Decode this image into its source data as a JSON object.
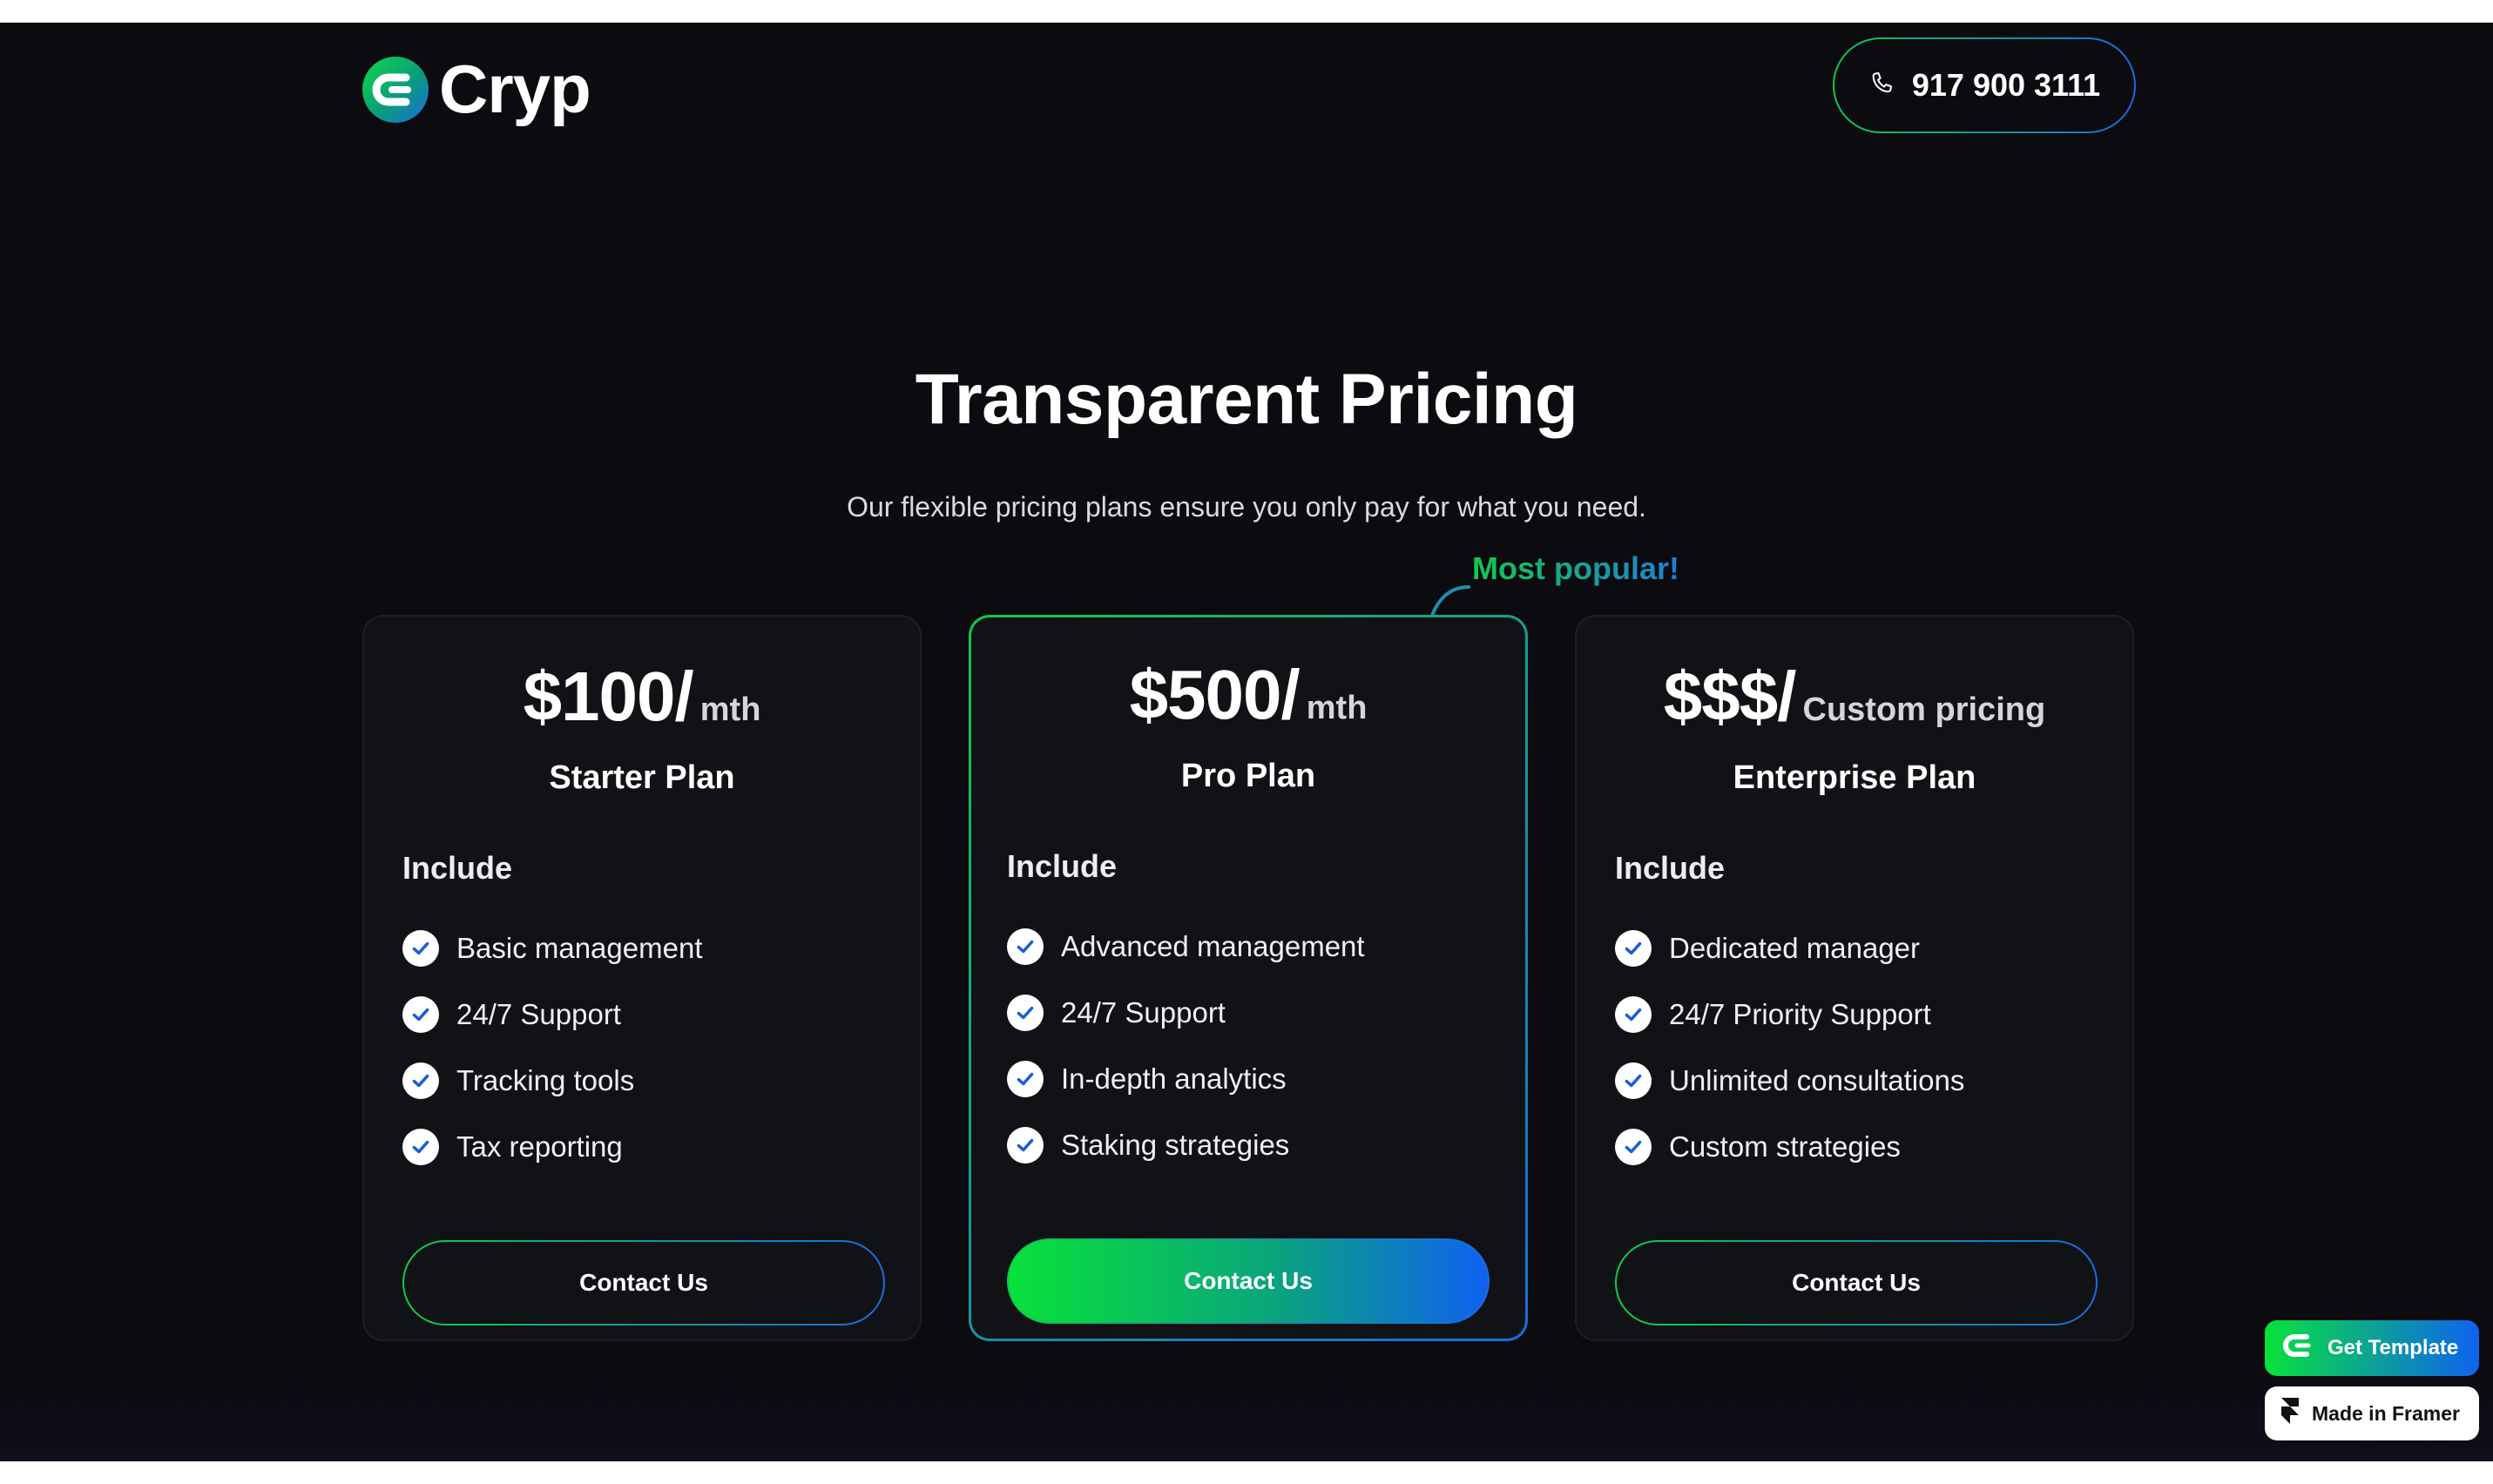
{
  "header": {
    "brand": "Cryp",
    "phone": "917 900 3111"
  },
  "hero": {
    "title": "Transparent Pricing",
    "subtitle": "Our flexible pricing plans ensure you only pay for what you need.",
    "popular_label": "Most popular!"
  },
  "plans": [
    {
      "price": "$100/",
      "period": "mth",
      "name": "Starter Plan",
      "include_label": "Include",
      "features": [
        "Basic management",
        "24/7 Support",
        "Tracking tools",
        "Tax reporting"
      ],
      "cta": "Contact Us"
    },
    {
      "price": "$500/",
      "period": "mth",
      "name": "Pro Plan",
      "include_label": "Include",
      "features": [
        "Advanced management",
        "24/7 Support",
        "In-depth analytics",
        "Staking strategies"
      ],
      "cta": "Contact Us"
    },
    {
      "price": "$$$/",
      "period": "Custom pricing",
      "name": "Enterprise Plan",
      "include_label": "Include",
      "features": [
        "Dedicated manager",
        "24/7 Priority Support",
        "Unlimited consultations",
        "Custom strategies"
      ],
      "cta": "Contact Us"
    }
  ],
  "badges": {
    "get_template": "Get Template",
    "made_in_framer": "Made in Framer"
  },
  "colors": {
    "background": "#0b0b10",
    "card": "#111216",
    "accent_green": "#10c94a",
    "accent_blue": "#1a6be0",
    "check_blue": "#1a5ed8"
  },
  "icons": {
    "logo": "cryp-logo-icon",
    "phone": "phone-icon",
    "check": "check-circle-icon",
    "arrow": "curved-arrow-icon",
    "framer": "framer-icon"
  }
}
